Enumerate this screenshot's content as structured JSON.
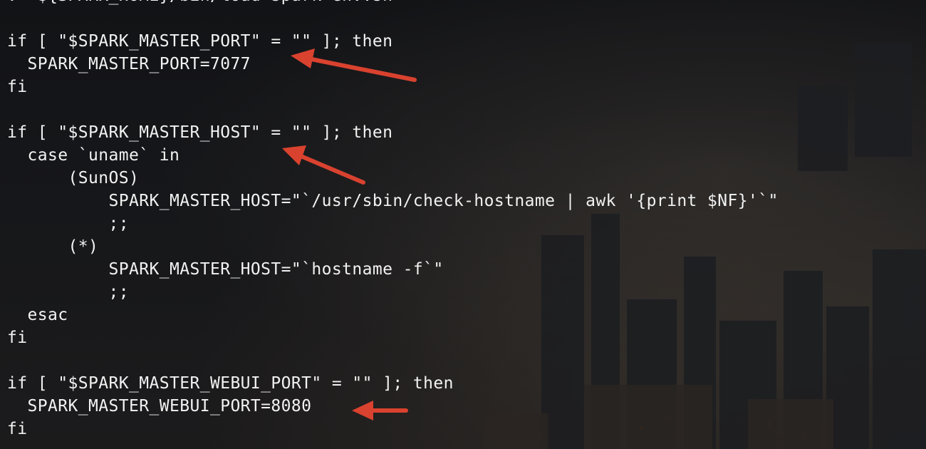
{
  "terminal": {
    "lines": [
      ". \"${SPARK_HOME}/bin/load-spark-env.sh\"",
      "",
      "if [ \"$SPARK_MASTER_PORT\" = \"\" ]; then",
      "  SPARK_MASTER_PORT=7077",
      "fi",
      "",
      "if [ \"$SPARK_MASTER_HOST\" = \"\" ]; then",
      "  case `uname` in",
      "      (SunOS)",
      "          SPARK_MASTER_HOST=\"`/usr/sbin/check-hostname | awk '{print $NF}'`\"",
      "          ;;",
      "      (*)",
      "          SPARK_MASTER_HOST=\"`hostname -f`\"",
      "          ;;",
      "  esac",
      "fi",
      "",
      "if [ \"$SPARK_MASTER_WEBUI_PORT\" = \"\" ]; then",
      "  SPARK_MASTER_WEBUI_PORT=8080",
      "fi"
    ]
  },
  "annotations": {
    "arrow_color": "#d9422f",
    "arrows": [
      {
        "target": "SPARK_MASTER_PORT=7077"
      },
      {
        "target": "if [ \"$SPARK_MASTER_HOST\" = \"\" ]; then"
      },
      {
        "target": "SPARK_MASTER_WEBUI_PORT=8080"
      }
    ]
  },
  "colors": {
    "text": "#f2f2f2",
    "background": "#141518"
  }
}
